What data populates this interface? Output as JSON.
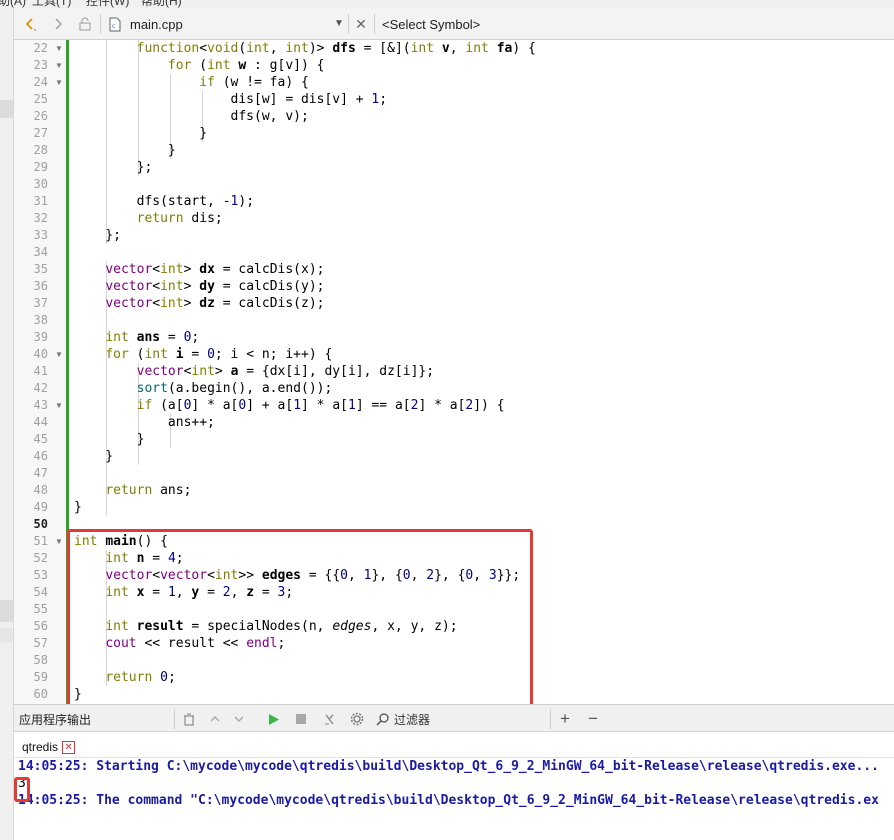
{
  "menu": {
    "items": [
      "助(A)",
      "工具(T)",
      "控件(W)",
      "帮助(H)"
    ]
  },
  "toolbar": {
    "back_icon": "back-arrow-icon",
    "forward_icon": "forward-arrow-icon",
    "lock_icon": "lock-icon",
    "file_icon": "cpp-file-icon",
    "file_name": "main.cpp",
    "symbol_placeholder": "<Select Symbol>"
  },
  "editor": {
    "current_line": 50,
    "lines": [
      {
        "n": 22,
        "fold": true
      },
      {
        "n": 23,
        "fold": true
      },
      {
        "n": 24,
        "fold": true
      },
      {
        "n": 25,
        "fold": false
      },
      {
        "n": 26,
        "fold": false
      },
      {
        "n": 27,
        "fold": false
      },
      {
        "n": 28,
        "fold": false
      },
      {
        "n": 29,
        "fold": false
      },
      {
        "n": 30,
        "fold": false
      },
      {
        "n": 31,
        "fold": false
      },
      {
        "n": 32,
        "fold": false
      },
      {
        "n": 33,
        "fold": false
      },
      {
        "n": 34,
        "fold": false
      },
      {
        "n": 35,
        "fold": false
      },
      {
        "n": 36,
        "fold": false
      },
      {
        "n": 37,
        "fold": false
      },
      {
        "n": 38,
        "fold": false
      },
      {
        "n": 39,
        "fold": false
      },
      {
        "n": 40,
        "fold": true
      },
      {
        "n": 41,
        "fold": false
      },
      {
        "n": 42,
        "fold": false
      },
      {
        "n": 43,
        "fold": true
      },
      {
        "n": 44,
        "fold": false
      },
      {
        "n": 45,
        "fold": false
      },
      {
        "n": 46,
        "fold": false
      },
      {
        "n": 47,
        "fold": false
      },
      {
        "n": 48,
        "fold": false
      },
      {
        "n": 49,
        "fold": false
      },
      {
        "n": 50,
        "fold": false
      },
      {
        "n": 51,
        "fold": true
      },
      {
        "n": 52,
        "fold": false
      },
      {
        "n": 53,
        "fold": false
      },
      {
        "n": 54,
        "fold": false
      },
      {
        "n": 55,
        "fold": false
      },
      {
        "n": 56,
        "fold": false
      },
      {
        "n": 57,
        "fold": false
      },
      {
        "n": 58,
        "fold": false
      },
      {
        "n": 59,
        "fold": false
      },
      {
        "n": 60,
        "fold": false
      }
    ],
    "code": [
      [
        [
          "        ",
          ""
        ],
        [
          "function",
          "kw"
        ],
        [
          "<",
          ""
        ],
        [
          "void",
          "kw"
        ],
        [
          "(",
          ""
        ],
        [
          "int",
          "kw"
        ],
        [
          ", ",
          ""
        ],
        [
          "int",
          "kw"
        ],
        [
          ")> ",
          ""
        ],
        [
          "dfs",
          "bold"
        ],
        [
          " = [&](",
          ""
        ],
        [
          "int",
          "kw"
        ],
        [
          " ",
          ""
        ],
        [
          "v",
          "bold"
        ],
        [
          ", ",
          ""
        ],
        [
          "int",
          "kw"
        ],
        [
          " ",
          ""
        ],
        [
          "fa",
          "bold"
        ],
        [
          ") {",
          ""
        ]
      ],
      [
        [
          "            ",
          ""
        ],
        [
          "for",
          "kw"
        ],
        [
          " (",
          ""
        ],
        [
          "int",
          "kw"
        ],
        [
          " ",
          ""
        ],
        [
          "w",
          "bold"
        ],
        [
          " : g[v]) {",
          ""
        ]
      ],
      [
        [
          "                ",
          ""
        ],
        [
          "if",
          "kw"
        ],
        [
          " (w != fa) {",
          ""
        ]
      ],
      [
        [
          "                    dis[w] = dis[v] + ",
          ""
        ],
        [
          "1",
          "num"
        ],
        [
          ";",
          ""
        ]
      ],
      [
        [
          "                    dfs(w, v);",
          ""
        ]
      ],
      [
        [
          "                }",
          ""
        ]
      ],
      [
        [
          "            }",
          ""
        ]
      ],
      [
        [
          "        };",
          ""
        ]
      ],
      [
        [
          "",
          ""
        ]
      ],
      [
        [
          "        dfs(start, -",
          ""
        ],
        [
          "1",
          "num"
        ],
        [
          ");",
          ""
        ]
      ],
      [
        [
          "        ",
          ""
        ],
        [
          "return",
          "kw"
        ],
        [
          " dis;",
          ""
        ]
      ],
      [
        [
          "    };",
          ""
        ]
      ],
      [
        [
          "",
          ""
        ]
      ],
      [
        [
          "    ",
          ""
        ],
        [
          "vector",
          "type"
        ],
        [
          "<",
          ""
        ],
        [
          "int",
          "kw"
        ],
        [
          "> ",
          ""
        ],
        [
          "dx",
          "bold"
        ],
        [
          " = calcDis(x);",
          ""
        ]
      ],
      [
        [
          "    ",
          ""
        ],
        [
          "vector",
          "type"
        ],
        [
          "<",
          ""
        ],
        [
          "int",
          "kw"
        ],
        [
          "> ",
          ""
        ],
        [
          "dy",
          "bold"
        ],
        [
          " = calcDis(y);",
          ""
        ]
      ],
      [
        [
          "    ",
          ""
        ],
        [
          "vector",
          "type"
        ],
        [
          "<",
          ""
        ],
        [
          "int",
          "kw"
        ],
        [
          "> ",
          ""
        ],
        [
          "dz",
          "bold"
        ],
        [
          " = calcDis(z);",
          ""
        ]
      ],
      [
        [
          "",
          ""
        ]
      ],
      [
        [
          "    ",
          ""
        ],
        [
          "int",
          "kw"
        ],
        [
          " ",
          ""
        ],
        [
          "ans",
          "bold"
        ],
        [
          " = ",
          ""
        ],
        [
          "0",
          "num"
        ],
        [
          ";",
          ""
        ]
      ],
      [
        [
          "    ",
          ""
        ],
        [
          "for",
          "kw"
        ],
        [
          " (",
          ""
        ],
        [
          "int",
          "kw"
        ],
        [
          " ",
          ""
        ],
        [
          "i",
          "bold"
        ],
        [
          " = ",
          ""
        ],
        [
          "0",
          "num"
        ],
        [
          "; i < n; i++) {",
          ""
        ]
      ],
      [
        [
          "        ",
          ""
        ],
        [
          "vector",
          "type"
        ],
        [
          "<",
          ""
        ],
        [
          "int",
          "kw"
        ],
        [
          "> ",
          ""
        ],
        [
          "a",
          "bold"
        ],
        [
          " = {dx[i], dy[i], dz[i]};",
          ""
        ]
      ],
      [
        [
          "        ",
          ""
        ],
        [
          "sort",
          "fn"
        ],
        [
          "(a.begin(), a.end());",
          ""
        ]
      ],
      [
        [
          "        ",
          ""
        ],
        [
          "if",
          "kw"
        ],
        [
          " (a[",
          ""
        ],
        [
          "0",
          "num"
        ],
        [
          "] * a[",
          ""
        ],
        [
          "0",
          "num"
        ],
        [
          "] + a[",
          ""
        ],
        [
          "1",
          "num"
        ],
        [
          "] * a[",
          ""
        ],
        [
          "1",
          "num"
        ],
        [
          "] == a[",
          ""
        ],
        [
          "2",
          "num"
        ],
        [
          "] * a[",
          ""
        ],
        [
          "2",
          "num"
        ],
        [
          "]) {",
          ""
        ]
      ],
      [
        [
          "            ans++;",
          ""
        ]
      ],
      [
        [
          "        }",
          ""
        ]
      ],
      [
        [
          "    }",
          ""
        ]
      ],
      [
        [
          "",
          ""
        ]
      ],
      [
        [
          "    ",
          ""
        ],
        [
          "return",
          "kw"
        ],
        [
          " ans;",
          ""
        ]
      ],
      [
        [
          "}",
          ""
        ]
      ],
      [
        [
          "",
          ""
        ]
      ],
      [
        [
          "int",
          "kw"
        ],
        [
          " ",
          ""
        ],
        [
          "main",
          "bold"
        ],
        [
          "() {",
          ""
        ]
      ],
      [
        [
          "    ",
          ""
        ],
        [
          "int",
          "kw"
        ],
        [
          " ",
          ""
        ],
        [
          "n",
          "bold"
        ],
        [
          " = ",
          ""
        ],
        [
          "4",
          "num"
        ],
        [
          ";",
          ""
        ]
      ],
      [
        [
          "    ",
          ""
        ],
        [
          "vector",
          "type"
        ],
        [
          "<",
          ""
        ],
        [
          "vector",
          "type"
        ],
        [
          "<",
          ""
        ],
        [
          "int",
          "kw"
        ],
        [
          ">> ",
          ""
        ],
        [
          "edges",
          "bold"
        ],
        [
          " = {{",
          ""
        ],
        [
          "0",
          "num"
        ],
        [
          ", ",
          ""
        ],
        [
          "1",
          "num"
        ],
        [
          "}, {",
          ""
        ],
        [
          "0",
          "num"
        ],
        [
          ", ",
          ""
        ],
        [
          "2",
          "num"
        ],
        [
          "}, {",
          ""
        ],
        [
          "0",
          "num"
        ],
        [
          ", ",
          ""
        ],
        [
          "3",
          "num"
        ],
        [
          "}};",
          ""
        ]
      ],
      [
        [
          "    ",
          ""
        ],
        [
          "int",
          "kw"
        ],
        [
          " ",
          ""
        ],
        [
          "x",
          "bold"
        ],
        [
          " = ",
          ""
        ],
        [
          "1",
          "num"
        ],
        [
          ", ",
          ""
        ],
        [
          "y",
          "bold"
        ],
        [
          " = ",
          ""
        ],
        [
          "2",
          "num"
        ],
        [
          ", ",
          ""
        ],
        [
          "z",
          "bold"
        ],
        [
          " = ",
          ""
        ],
        [
          "3",
          "num"
        ],
        [
          ";",
          ""
        ]
      ],
      [
        [
          "",
          ""
        ]
      ],
      [
        [
          "    ",
          ""
        ],
        [
          "int",
          "kw"
        ],
        [
          " ",
          ""
        ],
        [
          "result",
          "bold"
        ],
        [
          " = specialNodes(n, ",
          ""
        ],
        [
          "edges",
          "ital"
        ],
        [
          ", x, y, z);",
          ""
        ]
      ],
      [
        [
          "    ",
          ""
        ],
        [
          "cout",
          "type"
        ],
        [
          " << result << ",
          ""
        ],
        [
          "endl",
          "type"
        ],
        [
          ";",
          ""
        ]
      ],
      [
        [
          "",
          ""
        ]
      ],
      [
        [
          "    ",
          ""
        ],
        [
          "return",
          "kw"
        ],
        [
          " ",
          ""
        ],
        [
          "0",
          "num"
        ],
        [
          ";",
          ""
        ]
      ],
      [
        [
          "}",
          ""
        ]
      ]
    ],
    "colors": {
      "keyword": "#808000",
      "type": "#800080",
      "number": "#000080",
      "function": "#00677c",
      "line_number": "#a0a0a0",
      "change_bar": "#2aa52a",
      "highlight_box": "#e53935"
    }
  },
  "output_pane": {
    "title": "应用程序输出",
    "filter_label": "过滤器",
    "icons": [
      "clear-icon",
      "up-icon",
      "down-icon",
      "run-icon",
      "stop-icon",
      "settings-icon"
    ],
    "add_icon": "plus-icon",
    "remove_icon": "minus-icon",
    "tab_label": "qtredis",
    "lines": [
      "14:05:25: Starting C:\\mycode\\mycode\\qtredis\\build\\Desktop_Qt_6_9_2_MinGW_64_bit-Release\\release\\qtredis.exe...",
      "3",
      "14:05:25: The command \"C:\\mycode\\mycode\\qtredis\\build\\Desktop_Qt_6_9_2_MinGW_64_bit-Release\\release\\qtredis.ex"
    ],
    "text_color": "#1a1aa6"
  }
}
